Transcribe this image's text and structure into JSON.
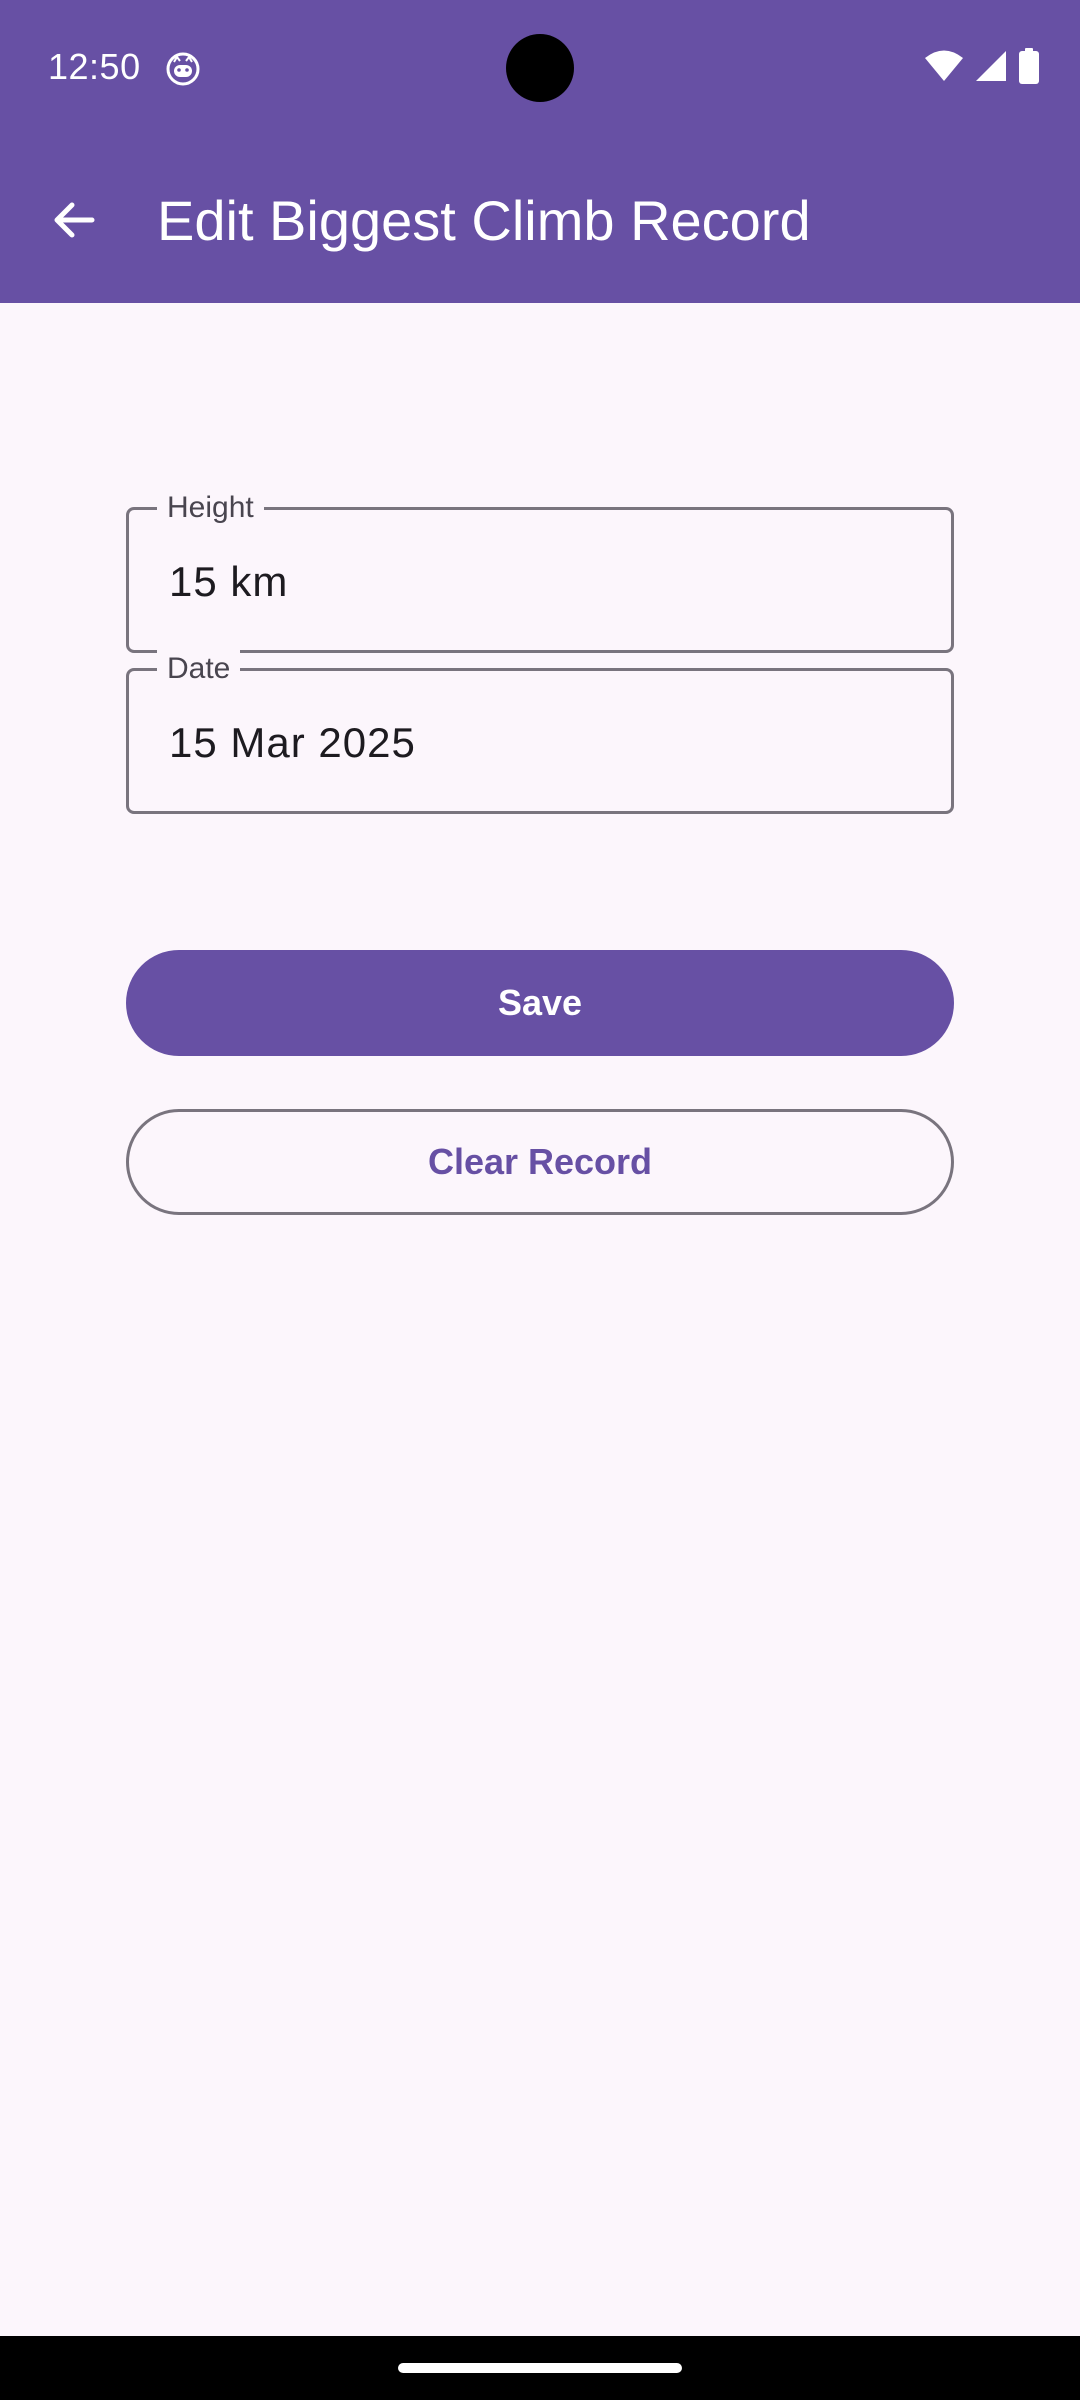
{
  "status_bar": {
    "time": "12:50",
    "app_notification_icon": "cat-face-icon",
    "icons": [
      "wifi-icon",
      "cellular-signal-icon",
      "battery-icon"
    ]
  },
  "app_bar": {
    "back_icon": "arrow-back-icon",
    "title": "Edit Biggest Climb Record"
  },
  "form": {
    "height": {
      "label": "Height",
      "value": "15 km"
    },
    "date": {
      "label": "Date",
      "value": "15 Mar 2025"
    }
  },
  "actions": {
    "save_label": "Save",
    "clear_label": "Clear Record"
  },
  "colors": {
    "primary": "#6750A4",
    "background": "#FCF6FC",
    "outline": "#79747E",
    "on_surface": "#1D1B20"
  }
}
